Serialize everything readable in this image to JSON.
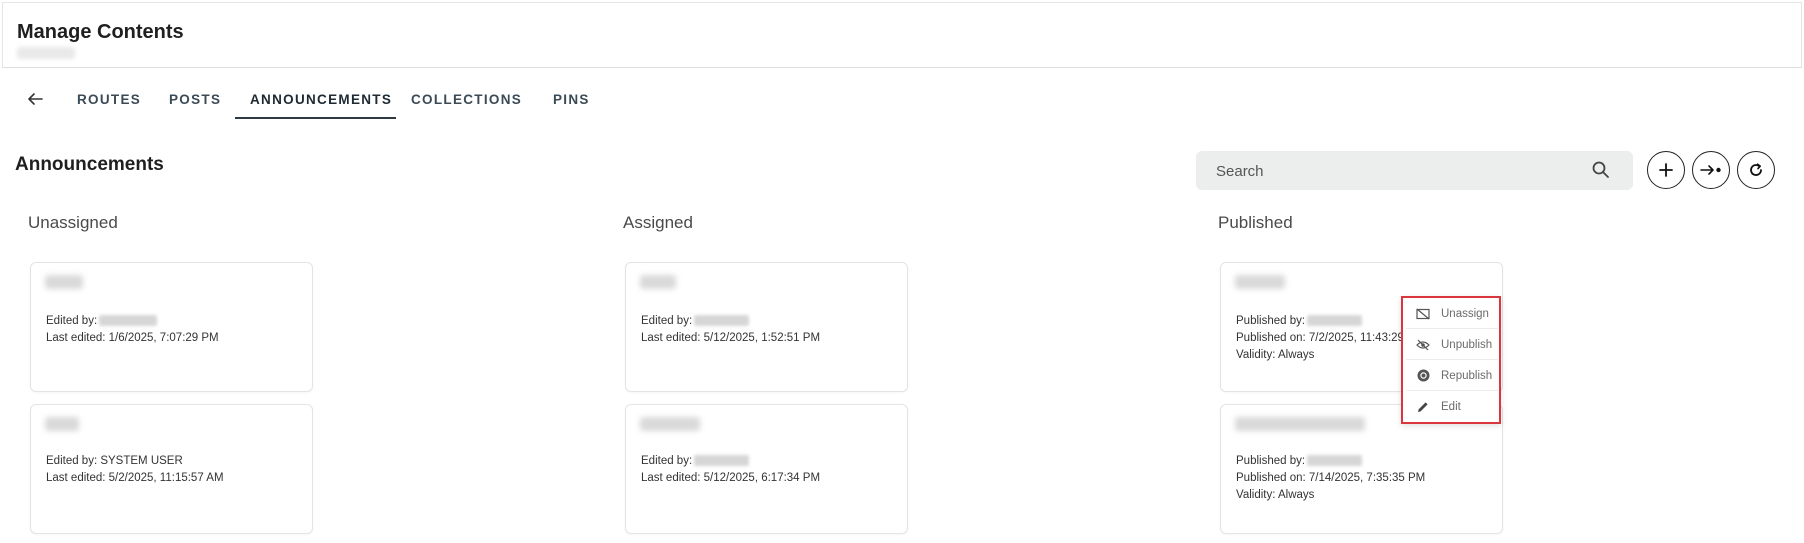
{
  "header": {
    "title": "Manage Contents"
  },
  "tabs": [
    {
      "label": "ROUTES"
    },
    {
      "label": "POSTS"
    },
    {
      "label": "ANNOUNCEMENTS",
      "active": true
    },
    {
      "label": "COLLECTIONS"
    },
    {
      "label": "PINS"
    }
  ],
  "section": {
    "title": "Announcements"
  },
  "search": {
    "placeholder": "Search"
  },
  "columns": {
    "unassigned": {
      "title": "Unassigned",
      "cards": [
        {
          "line1": "Edited by:",
          "line2": "Last edited: 1/6/2025, 7:07:29 PM"
        },
        {
          "line1": "Edited by: SYSTEM USER",
          "line2": "Last edited: 5/2/2025, 11:15:57 AM"
        }
      ]
    },
    "assigned": {
      "title": "Assigned",
      "cards": [
        {
          "line1": "Edited by:",
          "line2": "Last edited: 5/12/2025, 1:52:51 PM"
        },
        {
          "line1": "Edited by:",
          "line2": "Last edited: 5/12/2025, 6:17:34 PM"
        }
      ]
    },
    "published": {
      "title": "Published",
      "cards": [
        {
          "line1": "Published by:",
          "line2": "Published on: 7/2/2025, 11:43:29",
          "line3": "Validity: Always"
        },
        {
          "line1": "Published by:",
          "line2": "Published on: 7/14/2025, 7:35:35 PM",
          "line3": "Validity: Always"
        }
      ]
    }
  },
  "context_menu": {
    "items": [
      {
        "label": "Unassign",
        "icon": "unassign-icon"
      },
      {
        "label": "Unpublish",
        "icon": "eye-off-icon"
      },
      {
        "label": "Republish",
        "icon": "republish-icon"
      },
      {
        "label": "Edit",
        "icon": "pencil-icon"
      }
    ],
    "highlight_color": "#d9363e"
  },
  "colors": {
    "accent": "#2d3a44",
    "search_bg": "#eceeee"
  }
}
